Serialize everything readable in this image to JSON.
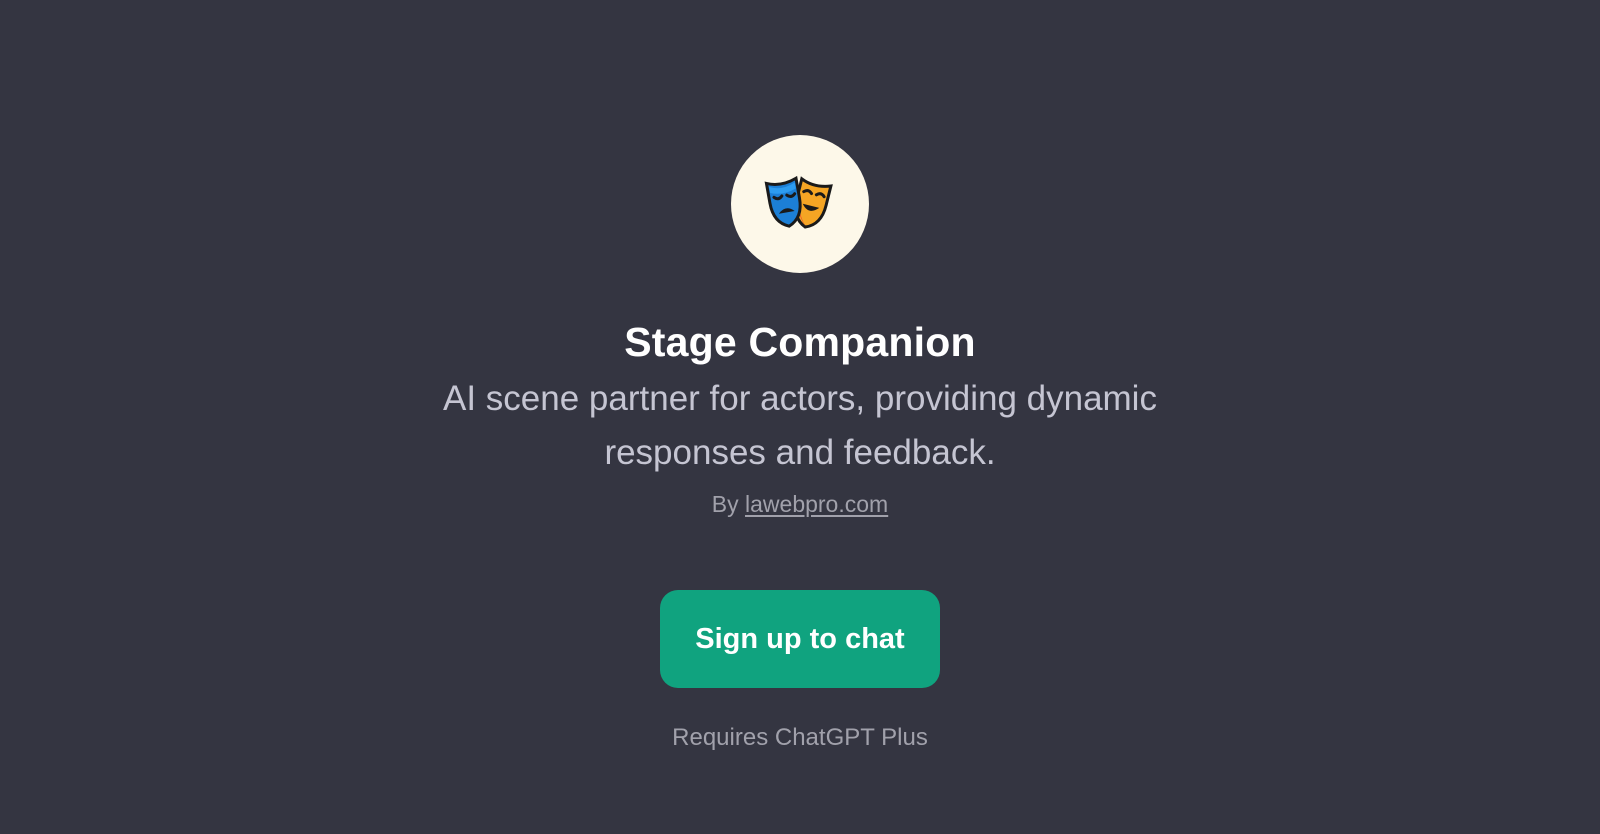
{
  "gpt": {
    "icon": "theater-masks-icon",
    "title": "Stage Companion",
    "description": "AI scene partner for actors, providing dynamic responses and feedback.",
    "byline_prefix": "By",
    "author_link": "lawebpro.com"
  },
  "actions": {
    "signup_label": "Sign up to chat",
    "requirement_note": "Requires ChatGPT Plus"
  },
  "colors": {
    "background": "#343541",
    "accent": "#10a37f",
    "avatar_bg": "#fdf8e9"
  }
}
